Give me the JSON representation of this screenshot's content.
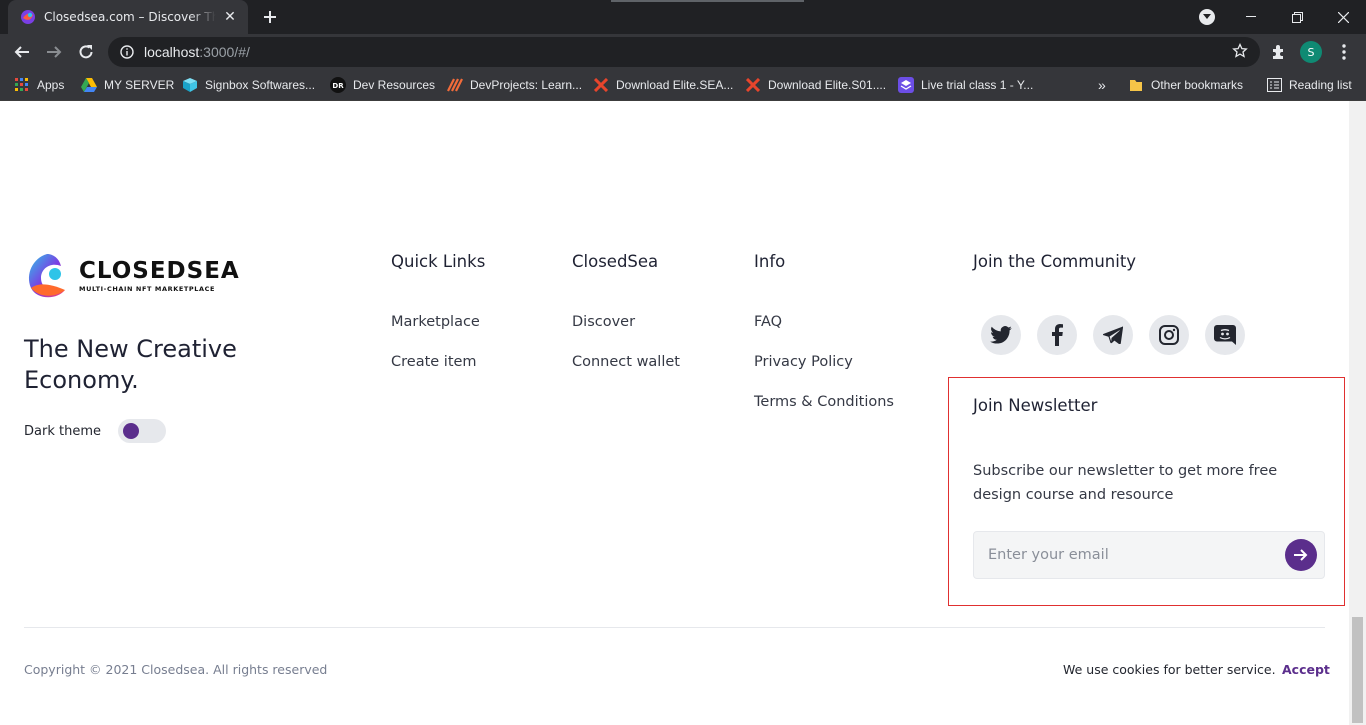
{
  "browser": {
    "tab_title": "Closedsea.com – Discover The Best NFTs",
    "url_host": "localhost",
    "url_rest": ":3000/#/",
    "profile_initial": "S",
    "bookmarks": [
      {
        "label": "Apps",
        "icon": "apps-grid-icon"
      },
      {
        "label": "MY SERVER",
        "icon": "google-drive-icon"
      },
      {
        "label": "Signbox Softwares...",
        "icon": "signbox-icon"
      },
      {
        "label": "Dev Resources",
        "icon": "dr-icon"
      },
      {
        "label": "DevProjects: Learn...",
        "icon": "devprojects-icon"
      },
      {
        "label": "Download Elite.SEA...",
        "icon": "x-logo-icon"
      },
      {
        "label": "Download Elite.S01....",
        "icon": "x-logo-icon"
      },
      {
        "label": "Live trial class 1 - Y...",
        "icon": "layers-icon"
      }
    ],
    "overflow": "»",
    "other_bookmarks": "Other bookmarks",
    "reading_list": "Reading list"
  },
  "footer": {
    "logo": {
      "brand": "CLOSEDSEA",
      "tagline": "MULTI-CHAIN NFT MARKETPLACE"
    },
    "headline": "The New Creative Economy.",
    "theme": {
      "label": "Dark theme",
      "enabled": false
    },
    "columns": [
      {
        "title": "Quick Links",
        "links": [
          "Marketplace",
          "Create item"
        ]
      },
      {
        "title": "ClosedSea",
        "links": [
          "Discover",
          "Connect wallet"
        ]
      },
      {
        "title": "Info",
        "links": [
          "FAQ",
          "Privacy Policy",
          "Terms & Conditions"
        ]
      }
    ],
    "community": {
      "title": "Join the Community",
      "socials": [
        "twitter-icon",
        "facebook-icon",
        "telegram-icon",
        "instagram-icon",
        "discord-icon"
      ]
    },
    "newsletter": {
      "title": "Join Newsletter",
      "text": "Subscribe our newsletter to get more free design course and resource",
      "placeholder": "Enter your email"
    },
    "copyright": "Copyright © 2021 Closedsea. All rights reserved",
    "cookie_text": "We use cookies for better service.",
    "accept_label": "Accept"
  },
  "colors": {
    "accent": "#5b2e8c",
    "highlight_border": "#e03030"
  }
}
